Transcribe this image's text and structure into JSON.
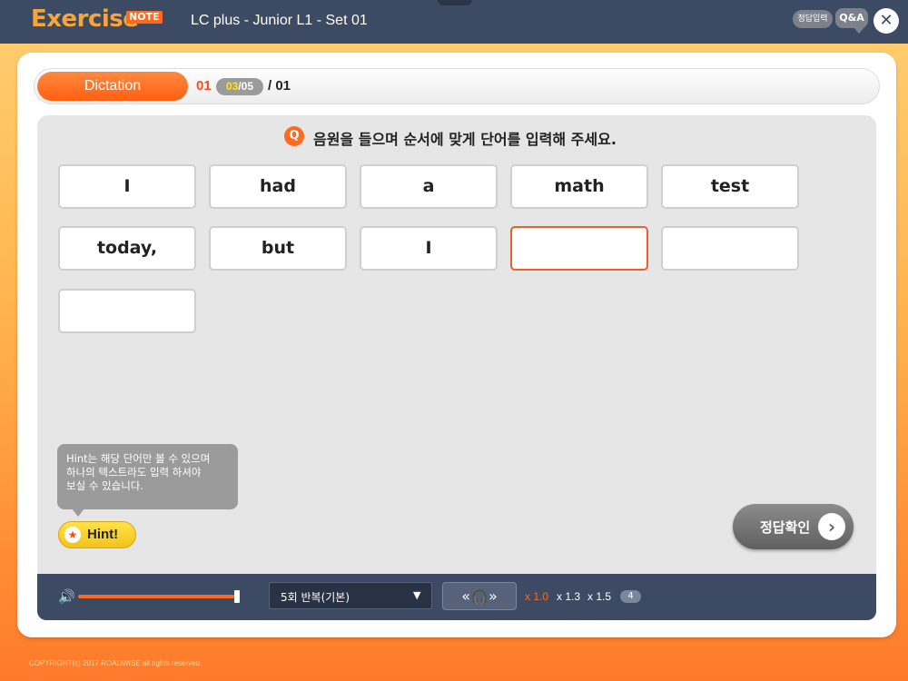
{
  "app": {
    "logo": "Exercise",
    "logo_tag": "NOTE",
    "title": "LC plus - Junior L1 - Set 01"
  },
  "header_actions": {
    "answer_input_label": "정답입력",
    "qa_label": "Q&A",
    "close_glyph": "✕"
  },
  "section": {
    "name": "Dictation",
    "progress_prefix": "01",
    "current": "03",
    "total": "05",
    "progress_suffix": "/ 01"
  },
  "question": {
    "marker": "Q",
    "text": "음원을 들으며 순서에 맞게 단어를 입력해 주세요."
  },
  "words": [
    {
      "text": "I",
      "active": false
    },
    {
      "text": "had",
      "active": false
    },
    {
      "text": "a",
      "active": false
    },
    {
      "text": "math",
      "active": false
    },
    {
      "text": "test",
      "active": false
    },
    {
      "text": "today,",
      "active": false
    },
    {
      "text": "but",
      "active": false
    },
    {
      "text": "I",
      "active": false
    },
    {
      "text": "",
      "active": true
    },
    {
      "text": "",
      "active": false
    },
    {
      "text": "",
      "active": false
    }
  ],
  "hint": {
    "tooltip_line1": "Hint는 해당 단어만 볼 수 있으며",
    "tooltip_line2": "하나의 텍스트라도 입력 하셔야",
    "tooltip_line3": "보실 수 있습니다.",
    "label": "Hint!",
    "icon": "star-icon"
  },
  "check_button": {
    "label": "정답확인",
    "icon": "chevron-right-icon"
  },
  "player": {
    "volume_level": 0.98,
    "repeat_selected": "5회 반복(기본)",
    "listen_icon": "headphones-icon",
    "speeds": [
      "x 1.0",
      "x 1.3",
      "x 1.5"
    ],
    "active_speed": "x 1.0",
    "count": "4"
  },
  "footer": {
    "copyright": "COPYRIGHT(c) 2017 ROADWISE all rights reserved."
  },
  "colors": {
    "accent": "#ff6a21",
    "navy": "#3d4a64",
    "active_border": "#e8602a"
  }
}
